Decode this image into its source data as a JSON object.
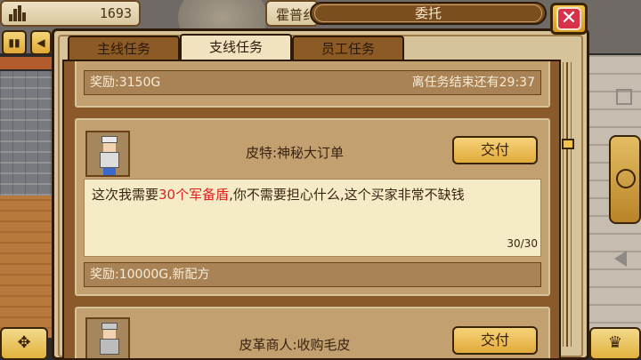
{
  "hud": {
    "gold_value": "1693",
    "name_partial": "霍普纟"
  },
  "dialog": {
    "title": "委托",
    "tabs": [
      {
        "label": "主线任务",
        "active": false
      },
      {
        "label": "支线任务",
        "active": true
      },
      {
        "label": "员工任务",
        "active": false
      }
    ]
  },
  "quests": [
    {
      "reward": "奖励:3150G",
      "time_left": "离任务结束还有29:37"
    },
    {
      "title": "皮特:神秘大订单",
      "deliver_label": "交付",
      "desc_prefix": "这次我需要",
      "desc_highlight": "30个军备盾",
      "desc_suffix": ",你不需要担心什么,这个买家非常不缺钱",
      "progress": "30/30",
      "reward": "奖励:10000G,新配方"
    },
    {
      "title": "皮革商人:收购毛皮",
      "deliver_label": "交付"
    }
  ],
  "colors": {
    "highlight": "#e02020",
    "panel": "#8a5a2a",
    "button": "#f2c44a",
    "close": "#d8324a"
  }
}
